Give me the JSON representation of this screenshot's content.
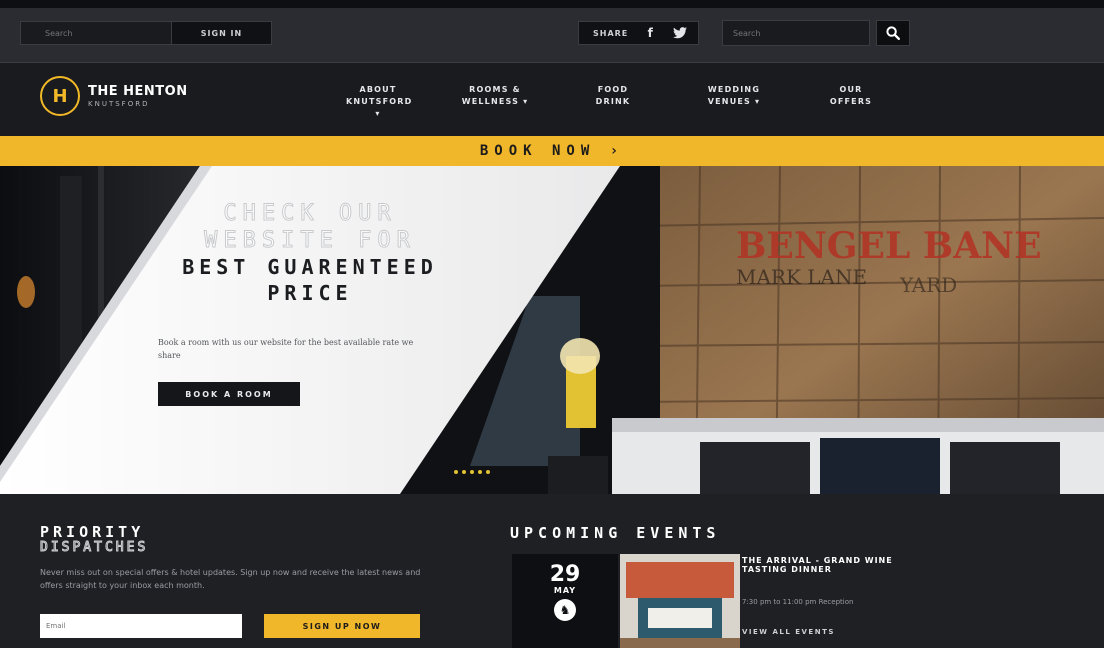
{
  "header": {
    "signin_placeholder": "Search",
    "signin_button": "SIGN IN",
    "share_label": "SHARE",
    "social": [
      {
        "name": "facebook-icon",
        "glyph": "f"
      },
      {
        "name": "twitter-icon",
        "glyph": "t"
      }
    ],
    "search_placeholder": "Search",
    "search_icon": "search-icon"
  },
  "nav": {
    "logo_mark": "H",
    "logo_title": "THE HENTON",
    "logo_subtitle": "KNUTSFORD",
    "items": [
      {
        "line1": "ABOUT",
        "line2": "KNUTSFORD ▾"
      },
      {
        "line1": "ROOMS &",
        "line2": "WELLNESS ▾"
      },
      {
        "line1": "FOOD",
        "line2": "DRINK"
      },
      {
        "line1": "WEDDING",
        "line2": "VENUES ▾"
      },
      {
        "line1": "OUR",
        "line2": "OFFERS"
      }
    ]
  },
  "book_band": {
    "label": "BOOK NOW ›"
  },
  "hero": {
    "line1": "CHECK OUR",
    "line2": "WEBSITE FOR",
    "line3": "BEST GUARENTEED",
    "line4": "PRICE",
    "subtext": "Book a room with us our website for the best available rate we share",
    "button": "BOOK A ROOM",
    "wall_sign_1": "BENGEL BANE",
    "wall_sign_2": "MARK LANE",
    "wall_sign_3": "YARD"
  },
  "newsletter": {
    "title": "PRIORITY",
    "subtitle": "DISPATCHES",
    "description": "Never miss out on special offers & hotel updates. Sign up now and receive the latest news and offers straight to your inbox each month.",
    "email_placeholder": "Email",
    "button": "SIGN UP NOW"
  },
  "events": {
    "title": "UPCOMING EVENTS",
    "card": {
      "day": "29",
      "month": "MAY",
      "logo_mark": "♞",
      "name": "THE ARRIVAL - GRAND WINE TASTING DINNER",
      "time": "7:30 pm to 11:00 pm Reception",
      "view_all": "VIEW ALL EVENTS"
    }
  }
}
